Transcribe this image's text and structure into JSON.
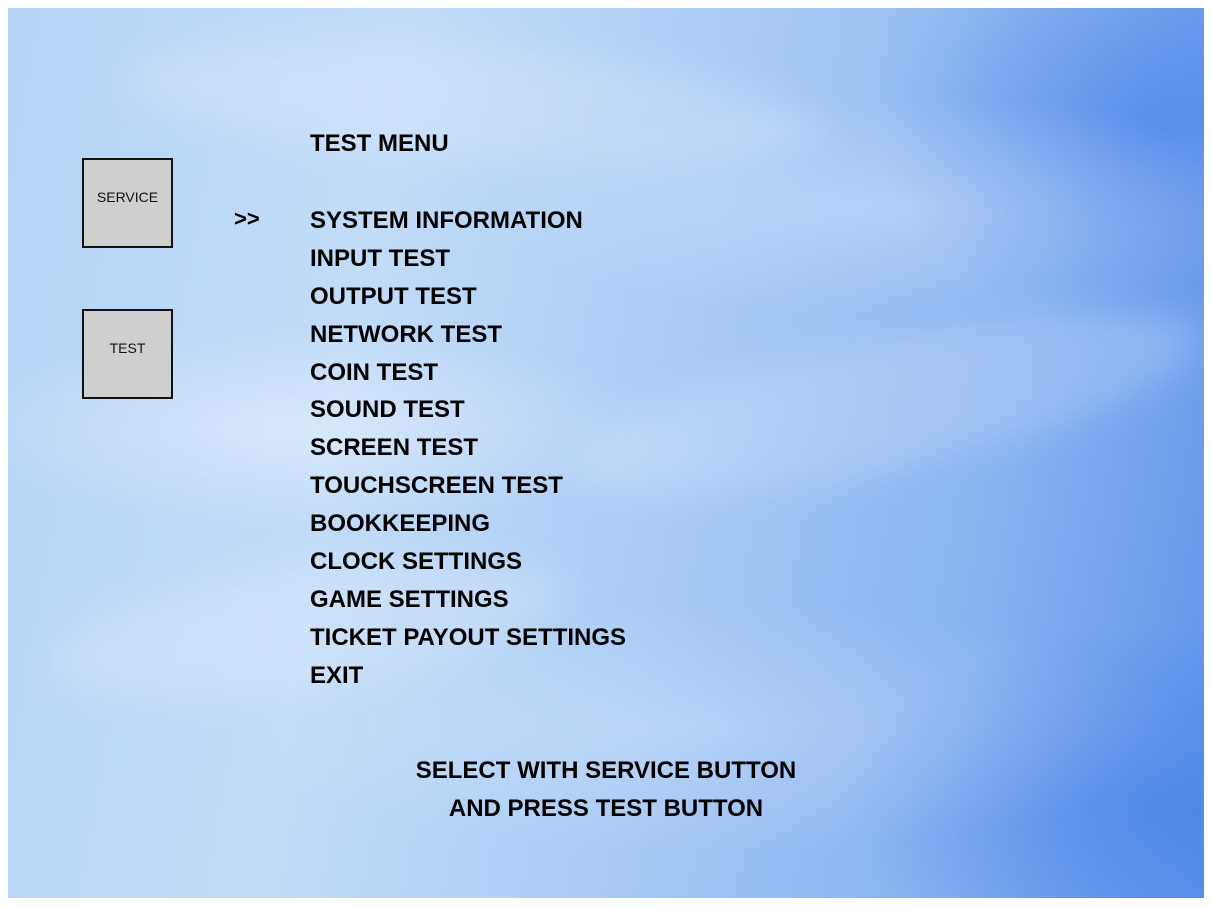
{
  "menu": {
    "title": "TEST MENU",
    "cursor": ">>",
    "items": [
      "SYSTEM INFORMATION",
      "INPUT TEST",
      "OUTPUT TEST",
      "NETWORK TEST",
      "COIN TEST",
      "SOUND TEST",
      "SCREEN TEST",
      "TOUCHSCREEN TEST",
      "BOOKKEEPING",
      "CLOCK SETTINGS",
      "GAME SETTINGS",
      "TICKET PAYOUT SETTINGS",
      "EXIT"
    ],
    "selected_index": 0
  },
  "buttons": {
    "service_label": "SERVICE",
    "test_label": "TEST"
  },
  "instructions": {
    "line1": "SELECT WITH SERVICE BUTTON",
    "line2": "AND PRESS TEST BUTTON"
  },
  "colors": {
    "background_accent": "#5f94ea",
    "background_light": "#c2dcf8",
    "button_fill": "#cfcfcf",
    "text": "#000000"
  }
}
